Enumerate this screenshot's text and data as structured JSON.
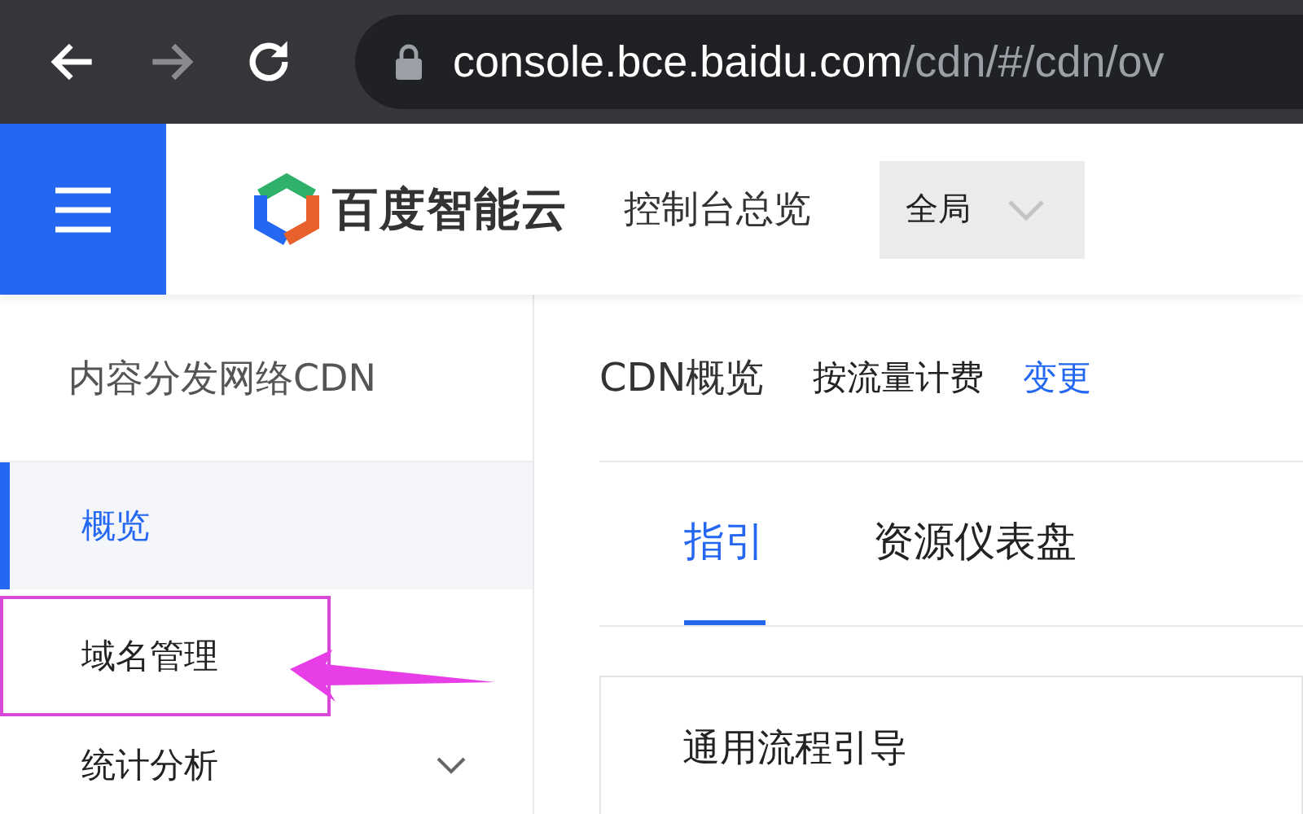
{
  "browser": {
    "url_host": "console.bce.baidu.com",
    "url_path": "/cdn/#/cdn/ov"
  },
  "header": {
    "brand": "百度智能云",
    "console_link": "控制台总览",
    "region": {
      "value": "全局"
    }
  },
  "sidebar": {
    "title": "内容分发网络CDN",
    "items": [
      {
        "label": "概览",
        "selected": true,
        "annotated": false,
        "expandable": false
      },
      {
        "label": "域名管理",
        "selected": false,
        "annotated": true,
        "expandable": false
      },
      {
        "label": "统计分析",
        "selected": false,
        "annotated": false,
        "expandable": true
      }
    ]
  },
  "main": {
    "title": "CDN概览",
    "billing": "按流量计费",
    "change_link": "变更",
    "tabs": [
      {
        "label": "指引",
        "selected": true
      },
      {
        "label": "资源仪表盘",
        "selected": false
      }
    ],
    "card": {
      "title": "通用流程引导"
    }
  }
}
